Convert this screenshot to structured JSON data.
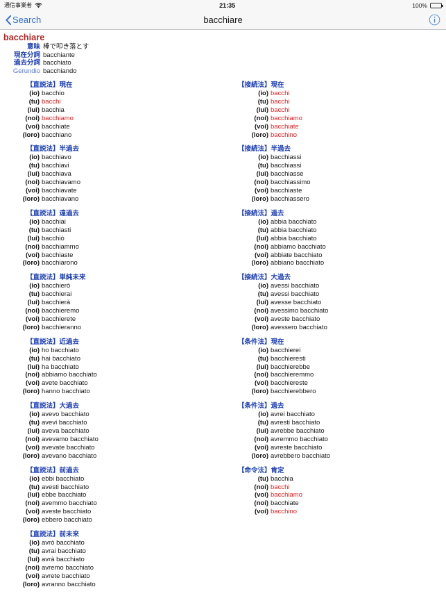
{
  "status_bar": {
    "carrier": "通信事業者",
    "wifi_icon": "wifi-icon",
    "time": "21:35",
    "battery_percent": "100%",
    "battery_icon": "battery-full-icon"
  },
  "nav_bar": {
    "back_label": "Search",
    "back_icon": "chevron-left-icon",
    "title": "bacchiare",
    "info_icon": "info-circle-icon"
  },
  "entry": {
    "headword": "bacchiare",
    "meta": [
      {
        "label": "意味",
        "value": "棒で叩き落とす",
        "latin": false
      },
      {
        "label": "現在分詞",
        "value": "bacchiante",
        "latin": false
      },
      {
        "label": "過去分詞",
        "value": "bacchiato",
        "latin": false
      },
      {
        "label": "Gerundio",
        "value": "bacchiando",
        "latin": true
      }
    ]
  },
  "colors": {
    "headword": "#b52424",
    "section_title": "#1d3fb4",
    "highlight_form": "#e02020",
    "nav_tint": "#2f6fd0",
    "body_text": "#161616"
  },
  "left_column": [
    {
      "title": "【直説法】現在",
      "rows": [
        {
          "pron": "(io)",
          "form": "bacchio",
          "hl": false
        },
        {
          "pron": "(tu)",
          "form": "bacchi",
          "hl": true
        },
        {
          "pron": "(lui)",
          "form": "bacchia",
          "hl": false
        },
        {
          "pron": "(noi)",
          "form": "bacchiamo",
          "hl": true
        },
        {
          "pron": "(voi)",
          "form": "bacchiate",
          "hl": false
        },
        {
          "pron": "(loro)",
          "form": "bacchiano",
          "hl": false
        }
      ]
    },
    {
      "title": "【直説法】半過去",
      "rows": [
        {
          "pron": "(io)",
          "form": "bacchiavo",
          "hl": false
        },
        {
          "pron": "(tu)",
          "form": "bacchiavi",
          "hl": false
        },
        {
          "pron": "(lui)",
          "form": "bacchiava",
          "hl": false
        },
        {
          "pron": "(noi)",
          "form": "bacchiavamo",
          "hl": false
        },
        {
          "pron": "(voi)",
          "form": "bacchiavate",
          "hl": false
        },
        {
          "pron": "(loro)",
          "form": "bacchiavano",
          "hl": false
        }
      ]
    },
    {
      "title": "【直説法】遠過去",
      "rows": [
        {
          "pron": "(io)",
          "form": "bacchiai",
          "hl": false
        },
        {
          "pron": "(tu)",
          "form": "bacchiasti",
          "hl": false
        },
        {
          "pron": "(lui)",
          "form": "bacchiò",
          "hl": false
        },
        {
          "pron": "(noi)",
          "form": "bacchiammo",
          "hl": false
        },
        {
          "pron": "(voi)",
          "form": "bacchiaste",
          "hl": false
        },
        {
          "pron": "(loro)",
          "form": "bacchiarono",
          "hl": false
        }
      ]
    },
    {
      "title": "【直説法】単純未来",
      "rows": [
        {
          "pron": "(io)",
          "form": "bacchierò",
          "hl": false
        },
        {
          "pron": "(tu)",
          "form": "bacchierai",
          "hl": false
        },
        {
          "pron": "(lui)",
          "form": "bacchierà",
          "hl": false
        },
        {
          "pron": "(noi)",
          "form": "bacchieremo",
          "hl": false
        },
        {
          "pron": "(voi)",
          "form": "bacchierete",
          "hl": false
        },
        {
          "pron": "(loro)",
          "form": "bacchieranno",
          "hl": false
        }
      ]
    },
    {
      "title": "【直説法】近過去",
      "rows": [
        {
          "pron": "(io)",
          "form": "ho bacchiato",
          "hl": false
        },
        {
          "pron": "(tu)",
          "form": "hai bacchiato",
          "hl": false
        },
        {
          "pron": "(lui)",
          "form": "ha bacchiato",
          "hl": false
        },
        {
          "pron": "(noi)",
          "form": "abbiamo bacchiato",
          "hl": false
        },
        {
          "pron": "(voi)",
          "form": "avete bacchiato",
          "hl": false
        },
        {
          "pron": "(loro)",
          "form": "hanno bacchiato",
          "hl": false
        }
      ]
    },
    {
      "title": "【直説法】大過去",
      "rows": [
        {
          "pron": "(io)",
          "form": "avevo bacchiato",
          "hl": false
        },
        {
          "pron": "(tu)",
          "form": "avevi bacchiato",
          "hl": false
        },
        {
          "pron": "(lui)",
          "form": "aveva bacchiato",
          "hl": false
        },
        {
          "pron": "(noi)",
          "form": "avevamo bacchiato",
          "hl": false
        },
        {
          "pron": "(voi)",
          "form": "avevate bacchiato",
          "hl": false
        },
        {
          "pron": "(loro)",
          "form": "avevano bacchiato",
          "hl": false
        }
      ]
    },
    {
      "title": "【直説法】前過去",
      "rows": [
        {
          "pron": "(io)",
          "form": "ebbi bacchiato",
          "hl": false
        },
        {
          "pron": "(tu)",
          "form": "avesti bacchiato",
          "hl": false
        },
        {
          "pron": "(lui)",
          "form": "ebbe bacchiato",
          "hl": false
        },
        {
          "pron": "(noi)",
          "form": "avemmo bacchiato",
          "hl": false
        },
        {
          "pron": "(voi)",
          "form": "aveste bacchiato",
          "hl": false
        },
        {
          "pron": "(loro)",
          "form": "ebbero bacchiato",
          "hl": false
        }
      ]
    },
    {
      "title": "【直説法】前未来",
      "rows": [
        {
          "pron": "(io)",
          "form": "avrò bacchiato",
          "hl": false
        },
        {
          "pron": "(tu)",
          "form": "avrai bacchiato",
          "hl": false
        },
        {
          "pron": "(lui)",
          "form": "avrà bacchiato",
          "hl": false
        },
        {
          "pron": "(noi)",
          "form": "avremo bacchiato",
          "hl": false
        },
        {
          "pron": "(voi)",
          "form": "avrete bacchiato",
          "hl": false
        },
        {
          "pron": "(loro)",
          "form": "avranno bacchiato",
          "hl": false
        }
      ]
    }
  ],
  "right_column": [
    {
      "title": "【接続法】現在",
      "rows": [
        {
          "pron": "(io)",
          "form": "bacchi",
          "hl": true
        },
        {
          "pron": "(tu)",
          "form": "bacchi",
          "hl": true
        },
        {
          "pron": "(lui)",
          "form": "bacchi",
          "hl": true
        },
        {
          "pron": "(noi)",
          "form": "bacchiamo",
          "hl": true
        },
        {
          "pron": "(voi)",
          "form": "bacchiate",
          "hl": true
        },
        {
          "pron": "(loro)",
          "form": "bacchino",
          "hl": true
        }
      ]
    },
    {
      "title": "【接続法】半過去",
      "rows": [
        {
          "pron": "(io)",
          "form": "bacchiassi",
          "hl": false
        },
        {
          "pron": "(tu)",
          "form": "bacchiassi",
          "hl": false
        },
        {
          "pron": "(lui)",
          "form": "bacchiasse",
          "hl": false
        },
        {
          "pron": "(noi)",
          "form": "bacchiassimo",
          "hl": false
        },
        {
          "pron": "(voi)",
          "form": "bacchiaste",
          "hl": false
        },
        {
          "pron": "(loro)",
          "form": "bacchiassero",
          "hl": false
        }
      ]
    },
    {
      "title": "【接続法】過去",
      "rows": [
        {
          "pron": "(io)",
          "form": "abbia bacchiato",
          "hl": false
        },
        {
          "pron": "(tu)",
          "form": "abbia bacchiato",
          "hl": false
        },
        {
          "pron": "(lui)",
          "form": "abbia bacchiato",
          "hl": false
        },
        {
          "pron": "(noi)",
          "form": "abbiamo bacchiato",
          "hl": false
        },
        {
          "pron": "(voi)",
          "form": "abbiate bacchiato",
          "hl": false
        },
        {
          "pron": "(loro)",
          "form": "abbiano bacchiato",
          "hl": false
        }
      ]
    },
    {
      "title": "【接続法】大過去",
      "rows": [
        {
          "pron": "(io)",
          "form": "avessi bacchiato",
          "hl": false
        },
        {
          "pron": "(tu)",
          "form": "avessi bacchiato",
          "hl": false
        },
        {
          "pron": "(lui)",
          "form": "avesse bacchiato",
          "hl": false
        },
        {
          "pron": "(noi)",
          "form": "avessimo bacchiato",
          "hl": false
        },
        {
          "pron": "(voi)",
          "form": "aveste bacchiato",
          "hl": false
        },
        {
          "pron": "(loro)",
          "form": "avessero bacchiato",
          "hl": false
        }
      ]
    },
    {
      "title": "【条件法】現在",
      "rows": [
        {
          "pron": "(io)",
          "form": "bacchierei",
          "hl": false
        },
        {
          "pron": "(tu)",
          "form": "bacchieresti",
          "hl": false
        },
        {
          "pron": "(lui)",
          "form": "bacchierebbe",
          "hl": false
        },
        {
          "pron": "(noi)",
          "form": "bacchieremmo",
          "hl": false
        },
        {
          "pron": "(voi)",
          "form": "bacchiereste",
          "hl": false
        },
        {
          "pron": "(loro)",
          "form": "bacchierebbero",
          "hl": false
        }
      ]
    },
    {
      "title": "【条件法】過去",
      "rows": [
        {
          "pron": "(io)",
          "form": "avrei bacchiato",
          "hl": false
        },
        {
          "pron": "(tu)",
          "form": "avresti bacchiato",
          "hl": false
        },
        {
          "pron": "(lui)",
          "form": "avrebbe bacchiato",
          "hl": false
        },
        {
          "pron": "(noi)",
          "form": "avremmo bacchiato",
          "hl": false
        },
        {
          "pron": "(voi)",
          "form": "avreste bacchiato",
          "hl": false
        },
        {
          "pron": "(loro)",
          "form": "avrebbero bacchiato",
          "hl": false
        }
      ]
    },
    {
      "title": "【命令法】肯定",
      "rows": [
        {
          "pron": "(tu)",
          "form": "bacchia",
          "hl": false
        },
        {
          "pron": "(noi)",
          "form": "bacchi",
          "hl": true
        },
        {
          "pron": "(voi)",
          "form": "bacchiamo",
          "hl": true
        },
        {
          "pron": "(noi)",
          "form": "bacchiate",
          "hl": false
        },
        {
          "pron": "(voi)",
          "form": "bacchino",
          "hl": true
        }
      ]
    }
  ]
}
